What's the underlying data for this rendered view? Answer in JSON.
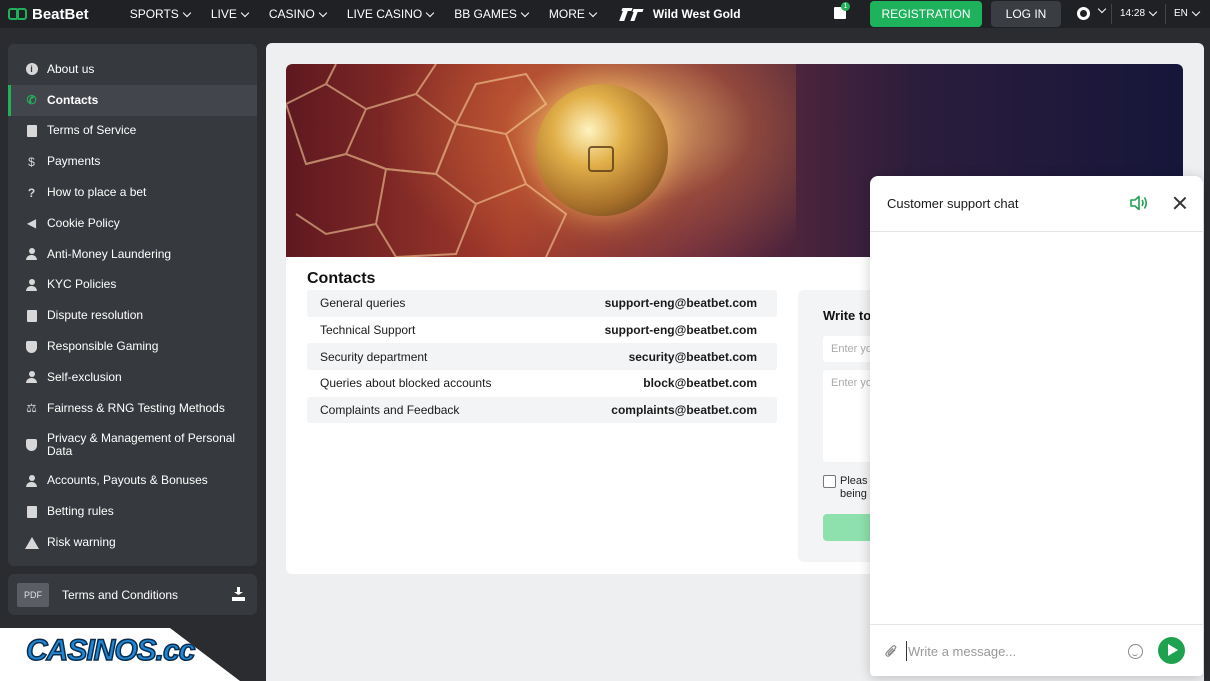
{
  "header": {
    "brand": "BeatBet",
    "nav": [
      {
        "label": "SPORTS"
      },
      {
        "label": "LIVE"
      },
      {
        "label": "CASINO"
      },
      {
        "label": "LIVE CASINO"
      },
      {
        "label": "BB GAMES"
      },
      {
        "label": "MORE"
      }
    ],
    "promo_label": "Wild West Gold",
    "gift_count": "1",
    "register_label": "REGISTRATION",
    "login_label": "LOG IN",
    "time": "14:28",
    "language": "EN",
    "accent_color": "#1fb25c"
  },
  "sidebar": {
    "items": [
      {
        "label": "About us",
        "icon": "info-icon"
      },
      {
        "label": "Contacts",
        "icon": "phone-icon",
        "active": true
      },
      {
        "label": "Terms of Service",
        "icon": "document-icon"
      },
      {
        "label": "Payments",
        "icon": "dollar-icon"
      },
      {
        "label": "How to place a bet",
        "icon": "question-icon"
      },
      {
        "label": "Cookie Policy",
        "icon": "megaphone-icon"
      },
      {
        "label": "Anti-Money Laundering",
        "icon": "user-lock-icon"
      },
      {
        "label": "KYC Policies",
        "icon": "user-check-icon"
      },
      {
        "label": "Dispute resolution",
        "icon": "document-icon"
      },
      {
        "label": "Responsible Gaming",
        "icon": "shield-icon"
      },
      {
        "label": "Self-exclusion",
        "icon": "user-icon"
      },
      {
        "label": "Fairness & RNG Testing Methods",
        "icon": "scales-icon"
      },
      {
        "label": "Privacy & Management of Personal Data",
        "icon": "shield-icon"
      },
      {
        "label": "Accounts, Payouts & Bonuses",
        "icon": "user-money-icon"
      },
      {
        "label": "Betting rules",
        "icon": "document-icon"
      },
      {
        "label": "Risk warning",
        "icon": "warning-icon"
      }
    ],
    "pdf_badge": "PDF",
    "pdf_label": "Terms and Conditions"
  },
  "contacts": {
    "title": "Contacts",
    "rows": [
      {
        "label": "General queries",
        "email": "support-eng@beatbet.com"
      },
      {
        "label": "Technical Support",
        "email": "support-eng@beatbet.com"
      },
      {
        "label": "Security department",
        "email": "security@beatbet.com"
      },
      {
        "label": "Queries about blocked accounts",
        "email": "block@beatbet.com"
      },
      {
        "label": "Complaints and Feedback",
        "email": "complaints@beatbet.com"
      }
    ]
  },
  "form": {
    "title": "Write to",
    "input_placeholder": "Enter yo",
    "textarea_placeholder": "Enter yo",
    "checkbox_label_line1": "Pleas",
    "checkbox_label_line2": "being"
  },
  "chat": {
    "title": "Customer support chat",
    "input_placeholder": "Write a message...",
    "send_color": "#1fa24f"
  },
  "watermark": {
    "text": "CASINOS.cc"
  }
}
